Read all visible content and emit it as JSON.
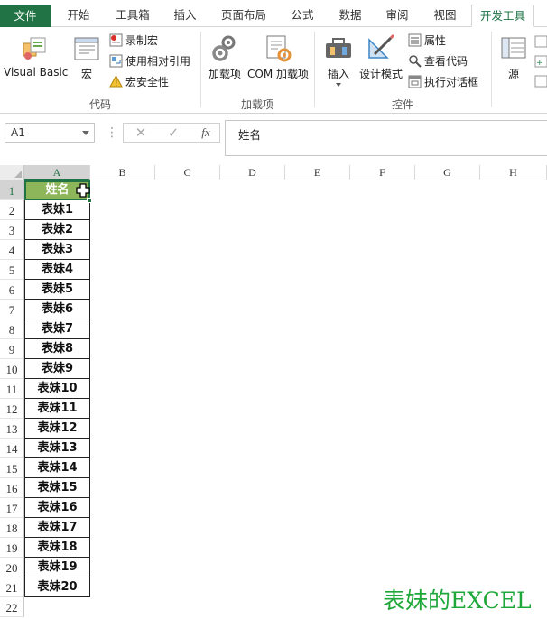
{
  "tabs": [
    {
      "id": "file",
      "label": "文件"
    },
    {
      "id": "home",
      "label": "开始"
    },
    {
      "id": "toolbox",
      "label": "工具箱"
    },
    {
      "id": "insert",
      "label": "插入"
    },
    {
      "id": "page-layout",
      "label": "页面布局"
    },
    {
      "id": "formulas",
      "label": "公式"
    },
    {
      "id": "data",
      "label": "数据"
    },
    {
      "id": "review",
      "label": "审阅"
    },
    {
      "id": "view",
      "label": "视图"
    },
    {
      "id": "developer",
      "label": "开发工具",
      "active": true
    }
  ],
  "ribbon": {
    "code": {
      "label": "代码",
      "visual_basic": "Visual Basic",
      "macros": "宏",
      "record_macro": "录制宏",
      "relative_ref": "使用相对引用",
      "macro_security": "宏安全性"
    },
    "addins": {
      "label": "加载项",
      "addins": "加载项",
      "com_addins": "COM 加载项"
    },
    "controls": {
      "label": "控件",
      "insert": "插入",
      "design_mode": "设计模式",
      "properties": "属性",
      "view_code": "查看代码",
      "run_dialog": "执行对话框"
    },
    "xml": {
      "source": "源"
    }
  },
  "formula_bar": {
    "name_box": "A1",
    "fx": "fx",
    "cancel": "✕",
    "enter": "✓",
    "content": "姓名"
  },
  "columns": [
    "A",
    "B",
    "C",
    "D",
    "E",
    "F",
    "G",
    "H"
  ],
  "rows": [
    "1",
    "2",
    "3",
    "4",
    "5",
    "6",
    "7",
    "8",
    "9",
    "10",
    "11",
    "12",
    "13",
    "14",
    "15",
    "16",
    "17",
    "18",
    "19",
    "20",
    "21",
    "22"
  ],
  "column_a": [
    "姓名",
    "表妹1",
    "表妹2",
    "表妹3",
    "表妹4",
    "表妹5",
    "表妹6",
    "表妹7",
    "表妹8",
    "表妹9",
    "表妹10",
    "表妹11",
    "表妹12",
    "表妹13",
    "表妹14",
    "表妹15",
    "表妹16",
    "表妹17",
    "表妹18",
    "表妹19",
    "表妹20"
  ],
  "watermark": "表妹的EXCEL",
  "colors": {
    "brand": "#217346",
    "header_fill": "#8db55a",
    "watermark": "#1fa83a"
  }
}
